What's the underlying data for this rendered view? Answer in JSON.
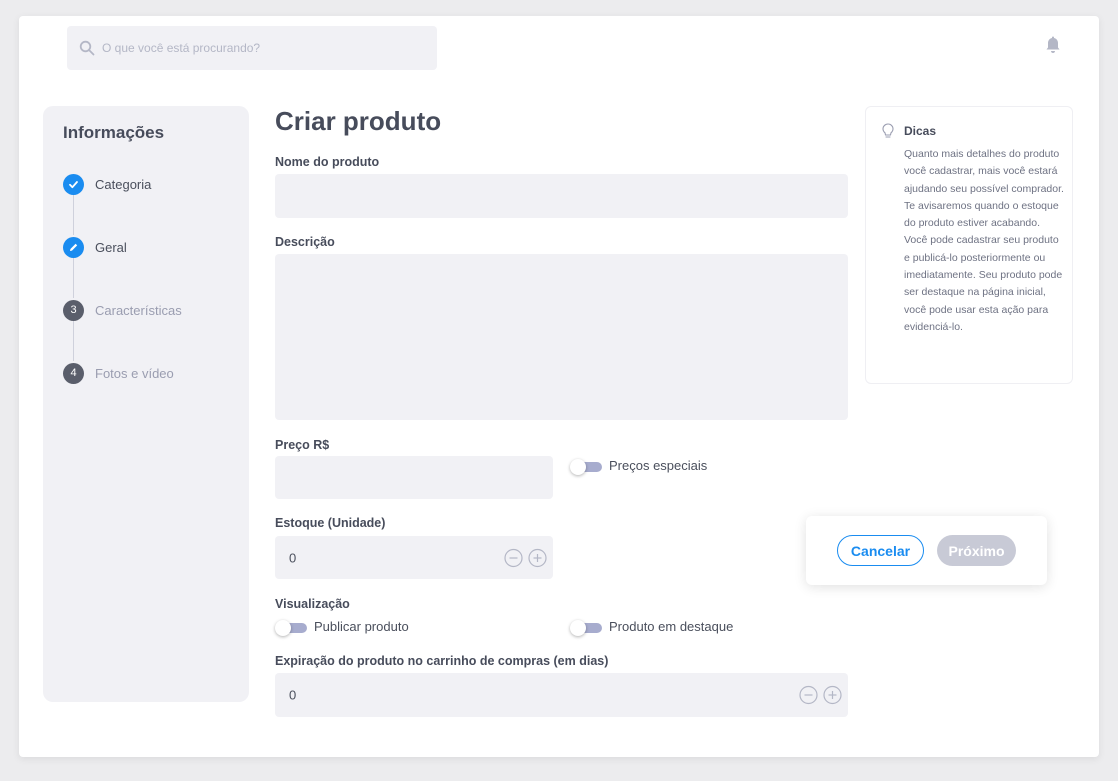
{
  "header": {
    "search_placeholder": "O que você está procurando?",
    "search_icon": "search-icon",
    "notification_icon": "bell-icon"
  },
  "sidebar": {
    "title": "Informações",
    "steps": [
      {
        "label": "Categoria",
        "marker": "check",
        "state": "done"
      },
      {
        "label": "Geral",
        "marker": "pencil",
        "state": "current"
      },
      {
        "label": "Características",
        "marker": "3",
        "state": "todo"
      },
      {
        "label": "Fotos e vídeo",
        "marker": "4",
        "state": "todo"
      }
    ]
  },
  "form": {
    "title": "Criar produto",
    "name_label": "Nome do produto",
    "name_value": "",
    "description_label": "Descrição",
    "description_value": "",
    "price_label": "Preço R$",
    "price_value": "",
    "special_prices_label": "Preços especiais",
    "special_prices_on": false,
    "stock_label": "Estoque (Unidade)",
    "stock_value": "0",
    "visibility_label": "Visualização",
    "publish_label": "Publicar produto",
    "publish_on": false,
    "featured_label": "Produto em destaque",
    "featured_on": false,
    "expiration_label": "Expiração do produto no carrinho de compras (em dias)",
    "expiration_value": "0"
  },
  "tips": {
    "title": "Dicas",
    "icon": "lightbulb-icon",
    "text": "Quanto mais detalhes do produto você cadastrar, mais você estará ajudando seu possível comprador. Te avisaremos quando o estoque do produto estiver acabando. Você pode cadastrar seu produto e publicá-lo posteriormente ou imediatamente. Seu produto pode ser destaque na página inicial, você pode usar esta ação para evidenciá-lo."
  },
  "actions": {
    "cancel_label": "Cancelar",
    "next_label": "Próximo"
  },
  "colors": {
    "accent": "#1a8cf0",
    "field_bg": "#f1f1f5",
    "disabled_button": "#c8cad6",
    "toggle_track": "#a7acce"
  }
}
